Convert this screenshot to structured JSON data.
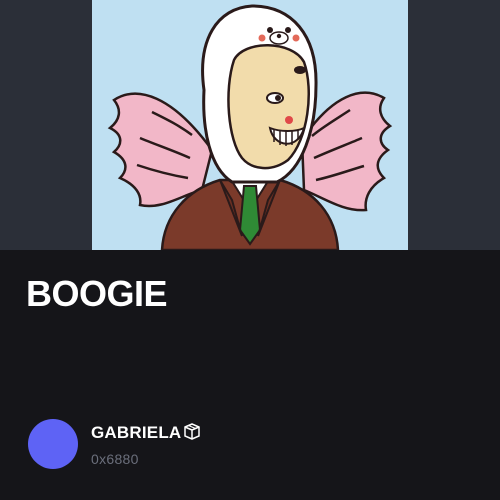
{
  "nft": {
    "title": "BOOGIE",
    "image_description_icon": "artwork-image"
  },
  "creator": {
    "name": "GABRIELA",
    "name_icon": "package-box-icon",
    "address": "0x6880",
    "avatar_color": "#5e63f5"
  },
  "colors": {
    "background": "#151519",
    "hero_background": "#2b2f38",
    "art_background": "#bfe0f2"
  }
}
